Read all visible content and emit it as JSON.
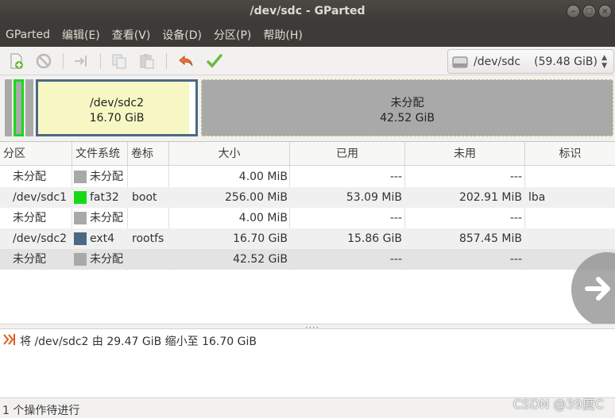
{
  "window": {
    "title": "/dev/sdc - GParted"
  },
  "menu": [
    "GParted",
    "编辑(E)",
    "查看(V)",
    "设备(D)",
    "分区(P)",
    "帮助(H)"
  ],
  "toolbar": {
    "buttons": [
      "new-partition-icon",
      "delete-icon",
      "resize-move-icon",
      "copy-icon",
      "paste-icon",
      "undo-icon",
      "apply-icon"
    ]
  },
  "device": {
    "name": "/dev/sdc",
    "size": "(59.48 GiB)"
  },
  "diskmap": {
    "selected": {
      "name": "/dev/sdc2",
      "size": "16.70 GiB"
    },
    "unallocated": {
      "name": "未分配",
      "size": "42.52 GiB"
    }
  },
  "table": {
    "headers": [
      "分区",
      "文件系统",
      "卷标",
      "大小",
      "已用",
      "未用",
      "标识"
    ],
    "rows": [
      {
        "partition": "未分配",
        "fs": "未分配",
        "label": "",
        "size": "4.00 MiB",
        "used": "---",
        "unused": "---",
        "flags": "",
        "color": "#a9a9a9"
      },
      {
        "partition": "/dev/sdc1",
        "fs": "fat32",
        "label": "boot",
        "size": "256.00 MiB",
        "used": "53.09 MiB",
        "unused": "202.91 MiB",
        "flags": "lba",
        "color": "#18d918"
      },
      {
        "partition": "未分配",
        "fs": "未分配",
        "label": "",
        "size": "4.00 MiB",
        "used": "---",
        "unused": "---",
        "flags": "",
        "color": "#a9a9a9"
      },
      {
        "partition": "/dev/sdc2",
        "fs": "ext4",
        "label": "rootfs",
        "size": "16.70 GiB",
        "used": "15.86 GiB",
        "unused": "857.45 MiB",
        "flags": "",
        "color": "#4b6983"
      },
      {
        "partition": "未分配",
        "fs": "未分配",
        "label": "",
        "size": "42.52 GiB",
        "used": "---",
        "unused": "---",
        "flags": "",
        "color": "#a9a9a9"
      }
    ]
  },
  "operations": [
    "将 /dev/sdc2 由 29.47 GiB 缩小至 16.70 GiB"
  ],
  "status": "1 个操作待进行",
  "watermark": "CSDN @39度C"
}
